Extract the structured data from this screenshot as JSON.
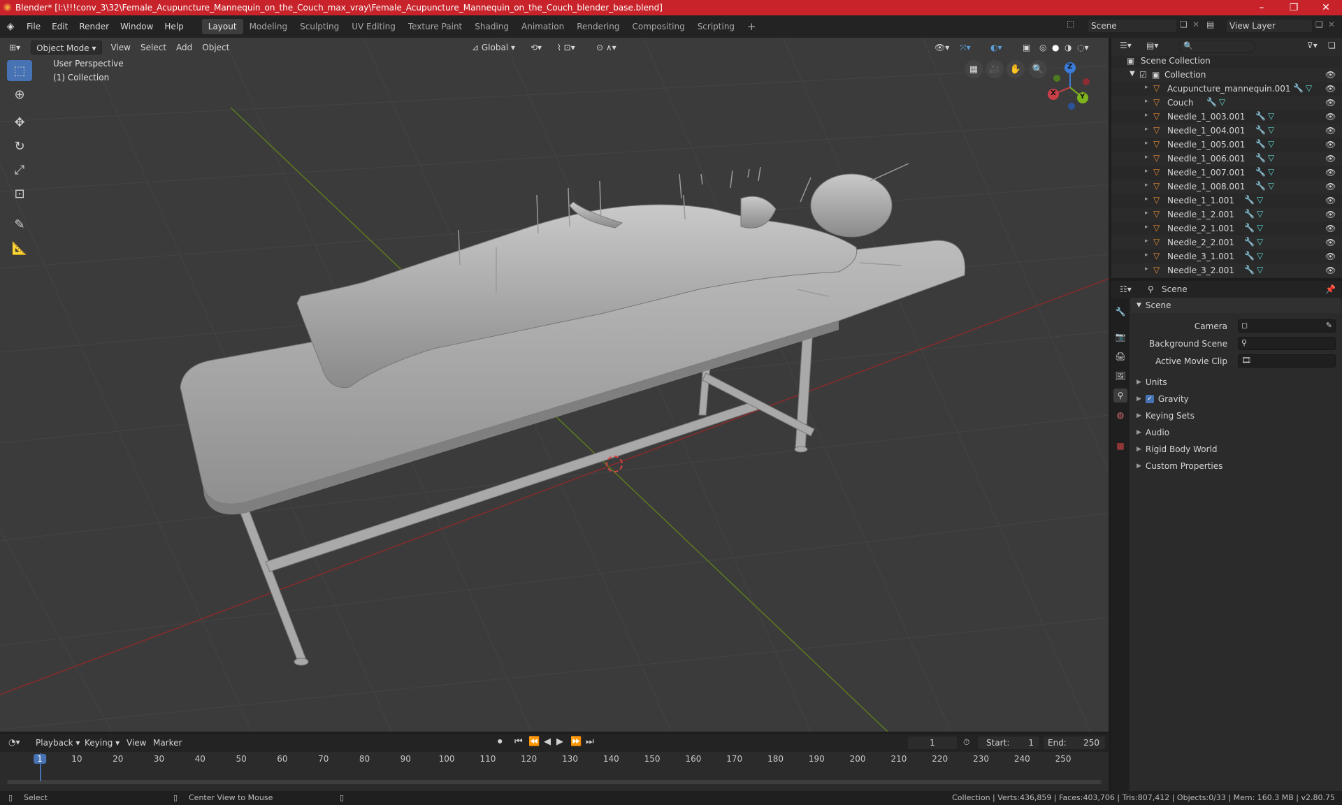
{
  "window": {
    "title": "Blender* [I:\\!!!conv_3\\32\\Female_Acupuncture_Mannequin_on_the_Couch_max_vray\\Female_Acupuncture_Mannequin_on_the_Couch_blender_base.blend]"
  },
  "menu": [
    "File",
    "Edit",
    "Render",
    "Window",
    "Help"
  ],
  "workspaces": [
    "Layout",
    "Modeling",
    "Sculpting",
    "UV Editing",
    "Texture Paint",
    "Shading",
    "Animation",
    "Rendering",
    "Compositing",
    "Scripting"
  ],
  "active_workspace": "Layout",
  "scene_selector": "Scene",
  "view_layer": "View Layer",
  "viewport_header": {
    "mode": "Object Mode",
    "menus": [
      "View",
      "Select",
      "Add",
      "Object"
    ],
    "transform": "Global"
  },
  "viewport": {
    "perspective": "User Perspective",
    "collection": "(1) Collection",
    "gizmo": {
      "x": "X",
      "y": "Y",
      "z": "Z"
    }
  },
  "outliner": {
    "root": "Scene Collection",
    "collection": "Collection",
    "objects": [
      "Acupuncture_mannequin.001",
      "Couch",
      "Needle_1_003.001",
      "Needle_1_004.001",
      "Needle_1_005.001",
      "Needle_1_006.001",
      "Needle_1_007.001",
      "Needle_1_008.001",
      "Needle_1_1.001",
      "Needle_1_2.001",
      "Needle_2_1.001",
      "Needle_2_2.001",
      "Needle_3_1.001",
      "Needle_3_2.001"
    ]
  },
  "properties": {
    "header": "Scene",
    "panel": "Scene",
    "camera_label": "Camera",
    "background_label": "Background Scene",
    "movie_clip_label": "Active Movie Clip",
    "sections": [
      "Units",
      "Gravity",
      "Keying Sets",
      "Audio",
      "Rigid Body World",
      "Custom Properties"
    ]
  },
  "timeline": {
    "menus": [
      "Playback",
      "Keying",
      "View",
      "Marker"
    ],
    "current_frame": "1",
    "start_label": "Start:",
    "start": "1",
    "end_label": "End:",
    "end": "250",
    "ticks": [
      "1",
      "10",
      "20",
      "30",
      "40",
      "50",
      "60",
      "70",
      "80",
      "90",
      "100",
      "110",
      "120",
      "130",
      "140",
      "150",
      "160",
      "170",
      "180",
      "190",
      "200",
      "210",
      "220",
      "230",
      "240",
      "250"
    ]
  },
  "status": {
    "select": "Select",
    "center": "Center View to Mouse",
    "stats": "Collection | Verts:436,859 | Faces:403,706 | Tris:807,412 | Objects:0/33 | Mem: 160.3 MB | v2.80.75"
  }
}
